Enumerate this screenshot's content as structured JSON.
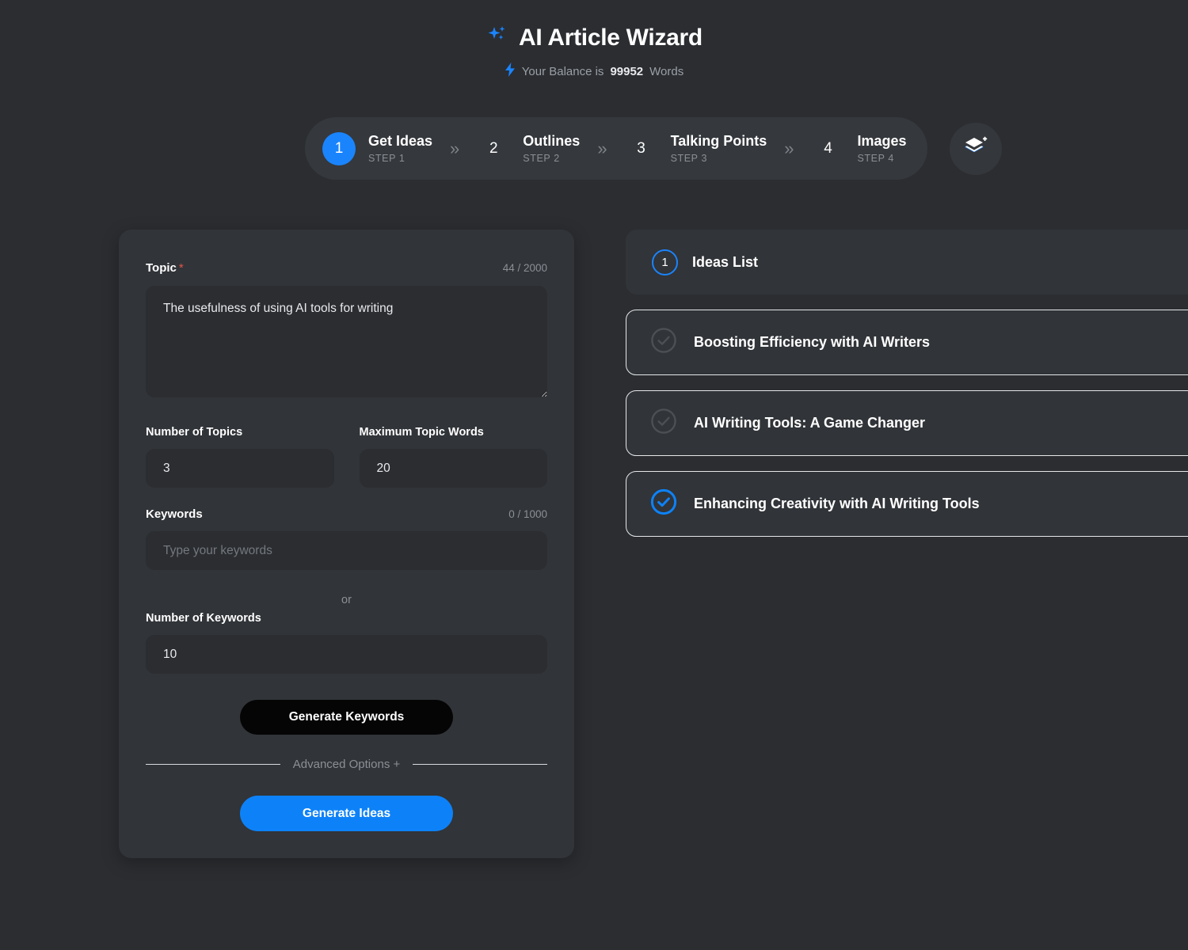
{
  "header": {
    "sparkle_icon": "sparkles-icon",
    "title": "AI Article Wizard",
    "bolt_icon": "lightning-bolt-icon",
    "balance_prefix": "Your Balance is",
    "balance_value": "99952",
    "balance_suffix": "Words"
  },
  "stepper": {
    "separator": "»",
    "layers_button_icon": "layers-plus-icon",
    "steps": [
      {
        "num": "1",
        "name": "Get Ideas",
        "sub": "STEP 1",
        "active": true
      },
      {
        "num": "2",
        "name": "Outlines",
        "sub": "STEP 2",
        "active": false
      },
      {
        "num": "3",
        "name": "Talking Points",
        "sub": "STEP 3",
        "active": false
      },
      {
        "num": "4",
        "name": "Images",
        "sub": "STEP 4",
        "active": false
      }
    ]
  },
  "form": {
    "topic": {
      "label": "Topic",
      "required_mark": "*",
      "counter": "44 / 2000",
      "value": "The usefulness of using AI tools for writing",
      "placeholder": "Type your topic"
    },
    "number_of_topics": {
      "label": "Number of Topics",
      "value": "3"
    },
    "maximum_topic_words": {
      "label": "Maximum Topic Words",
      "value": "20"
    },
    "keywords": {
      "label": "Keywords",
      "counter": "0 / 1000",
      "value": "",
      "placeholder": "Type your keywords"
    },
    "or_text": "or",
    "number_of_keywords": {
      "label": "Number of Keywords",
      "value": "10"
    },
    "generate_keywords_button": "Generate Keywords",
    "advanced_options": "Advanced Options +",
    "generate_ideas_button": "Generate Ideas"
  },
  "ideas": {
    "badge": "1",
    "title": "Ideas List",
    "items": [
      {
        "text": "Boosting Efficiency with AI Writers",
        "selected": false
      },
      {
        "text": "AI Writing Tools: A Game Changer",
        "selected": false
      },
      {
        "text": "Enhancing Creativity with AI Writing Tools",
        "selected": true
      }
    ]
  },
  "colors": {
    "accent": "#0d82f8",
    "page_bg": "#2b2d31",
    "card_bg": "#313438",
    "input_bg": "#2b2d31",
    "stepper_bg": "#35383c",
    "required_star": "#e0544a",
    "muted_text": "#8b9097",
    "card_border": "#e5e7e9",
    "dark_button": "#050505"
  }
}
